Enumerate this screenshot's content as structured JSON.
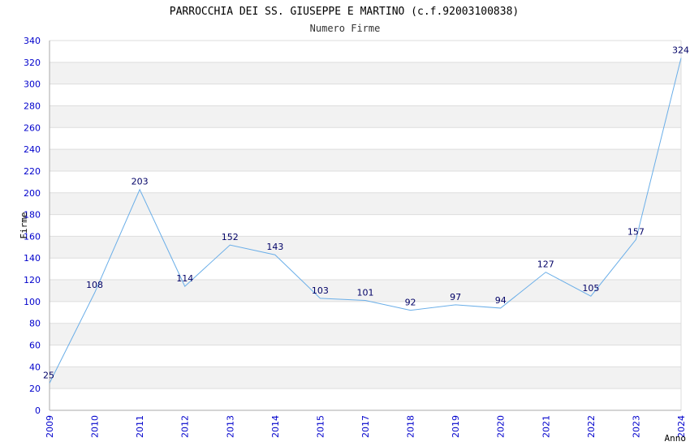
{
  "chart_data": {
    "type": "line",
    "title": "PARROCCHIA DEI SS. GIUSEPPE E MARTINO (c.f.92003100838)",
    "subtitle": "Numero Firme",
    "xlabel": "Anno",
    "ylabel": "Firme",
    "categories": [
      "2009",
      "2010",
      "2011",
      "2012",
      "2013",
      "2014",
      "2015",
      "2017",
      "2018",
      "2019",
      "2020",
      "2021",
      "2022",
      "2023",
      "2024"
    ],
    "values": [
      25,
      108,
      203,
      114,
      152,
      143,
      103,
      101,
      92,
      97,
      94,
      127,
      105,
      157,
      324
    ],
    "ylim": [
      0,
      340
    ],
    "ytick_step": 20,
    "grid": true,
    "colors": {
      "line": "#6aaee8",
      "tick_text": "#0000cc",
      "band": "#f2f2f2",
      "gridline": "#dddddd",
      "data_label": "#000066"
    }
  }
}
